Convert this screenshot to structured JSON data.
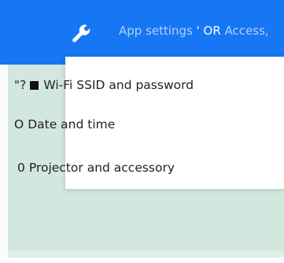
{
  "header": {
    "title_prefix": "App settings",
    "separator": " ' OR ",
    "title_suffix": "Access,"
  },
  "menu": {
    "items": [
      {
        "mark": "\"?",
        "label": "Wi-Fi SSID and password"
      },
      {
        "mark": "O",
        "label": "Date and time"
      },
      {
        "mark": "0",
        "label": "Projector and accessory"
      }
    ]
  },
  "colors": {
    "header_bg": "#1676f3",
    "backdrop": "#d2e7de"
  },
  "icons": {
    "header_icon": "wrench-icon"
  }
}
